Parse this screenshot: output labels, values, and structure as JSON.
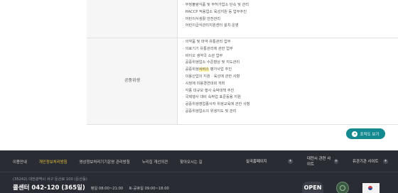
{
  "duties_top": [
    "부정불량식품 및 무허가업소 단속 및 관리",
    "HACCP 적용업소 육성지원 등 업무추진",
    "어린이식생활 안전관리",
    "어린이급식관리지원센터 설치·운영"
  ],
  "category_label": "공중위생",
  "duties_public_health": [
    "의약품 및 마약 유통관리 업무",
    "의료기기 유통관리에 관한 업무",
    "바이오 생약국 소관 업무",
    "공중위생업소 수준향상 및 지도관리",
    "공중위생서비스 평가사업 추진",
    "이용산업의 지원 · 육성에 관한 사항",
    "시정에 미용경연대회 개최",
    "각종 대규모 행사 숙박대책 추진",
    "국제행사 대비 숙박업 표준등용 지원",
    "공중위생영업종사자 위생교육에 관한 사항",
    "공중위생업소의 위생지도 및 관리"
  ],
  "highlight_term": "서비스",
  "org_button": {
    "icon": "+",
    "label": "조직도 보기"
  },
  "footer": {
    "links": [
      "이용안내",
      "개인정보처리방침",
      "영상정보처리기기운영 관리방침",
      "누리집 개선의견",
      "찾아오시는 길"
    ],
    "active_link_index": 1,
    "site_selectors": [
      {
        "label": "실국홈페이지",
        "icon": "+"
      },
      {
        "label": "대전시 관련 사이트",
        "icon": "+"
      },
      {
        "label": "유관기관 사이트",
        "icon": "+"
      }
    ],
    "address": "(35242) 대전광역시 서구 둔산로 100 (둔산동)",
    "tel": "콜센터 042-120 (365일)",
    "hours_weekday": "평일 08:00~21:00",
    "hours_holiday": "토·공휴일 09:00~18:00",
    "mark_open": "OPEN"
  },
  "colors": {
    "accent": "#14898f",
    "footer_bg": "#2a2c33",
    "footer_active": "#e9c53b"
  }
}
